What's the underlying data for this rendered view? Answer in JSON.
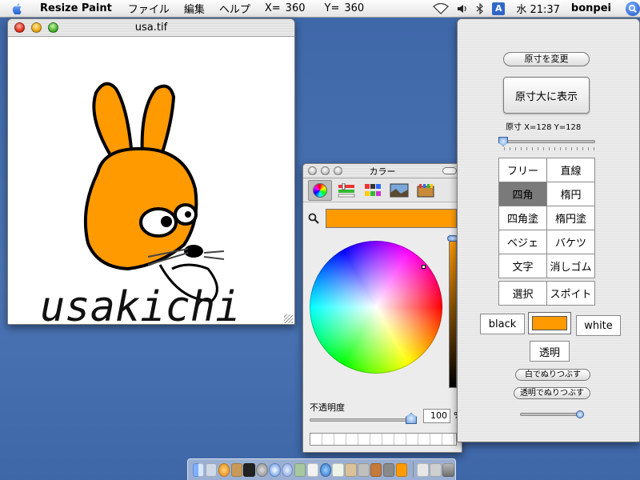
{
  "menubar": {
    "app_name": "Resize Paint",
    "menus": [
      "ファイル",
      "編集",
      "ヘルプ"
    ],
    "x_label": "X=",
    "x_value": "360",
    "y_label": "Y=",
    "y_value": "360",
    "input_source": "A",
    "clock": "水 21:37",
    "user": "bonpei"
  },
  "image_window": {
    "title": "usa.tif",
    "image_text": "usakichi"
  },
  "color_panel": {
    "title": "カラー",
    "modes": [
      "color-wheel",
      "color-sliders",
      "color-palettes",
      "image-palettes",
      "crayons"
    ],
    "current_color": "#ff9a00",
    "opacity_label": "不透明度",
    "opacity_value": "100",
    "opacity_unit": "%"
  },
  "tool_palette": {
    "actual_size_change": "原寸を変更",
    "show_actual_size": "原寸大に表示",
    "actual_size_label": "原寸 X=128 Y=128",
    "tools": [
      {
        "label": "フリー",
        "selected": false
      },
      {
        "label": "直線",
        "selected": false
      },
      {
        "label": "四角",
        "selected": true
      },
      {
        "label": "楕円",
        "selected": false
      },
      {
        "label": "四角塗",
        "selected": false
      },
      {
        "label": "楕円塗",
        "selected": false
      },
      {
        "label": "ベジェ",
        "selected": false
      },
      {
        "label": "バケツ",
        "selected": false
      },
      {
        "label": "文字",
        "selected": false
      },
      {
        "label": "消しゴム",
        "selected": false
      }
    ],
    "tools2": [
      {
        "label": "選択"
      },
      {
        "label": "スポイト"
      }
    ],
    "black_label": "black",
    "white_label": "white",
    "current_color": "#ff9a00",
    "transparent_label": "透明",
    "fill_white_label": "白でぬりつぶす",
    "fill_transparent_label": "透明でぬりつぶす"
  },
  "colors": {
    "desktop": "#3e67a8",
    "accent": "#ff9a00",
    "selected_tool": "#7a7a7a"
  }
}
